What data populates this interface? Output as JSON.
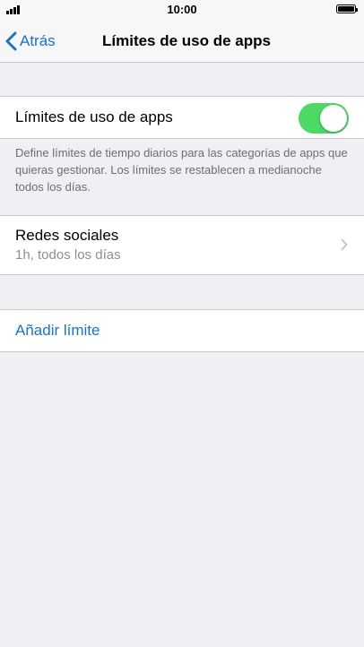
{
  "status_bar": {
    "time": "10:00"
  },
  "nav": {
    "back_label": "Atrás",
    "title": "Límites de uso de apps"
  },
  "limits_toggle": {
    "label": "Límites de uso de apps",
    "on": true,
    "on_color": "#4CD964"
  },
  "description": "Define límites de tiempo diarios para las categorías de apps que quieras gestionar. Los límites se restablecen a medianoche todos los días.",
  "limits": [
    {
      "title": "Redes sociales",
      "subtitle": "1h, todos los días"
    }
  ],
  "add_limit_label": "Añadir límite",
  "colors": {
    "accent": "#1A73C9",
    "background": "#EFEFF4"
  }
}
